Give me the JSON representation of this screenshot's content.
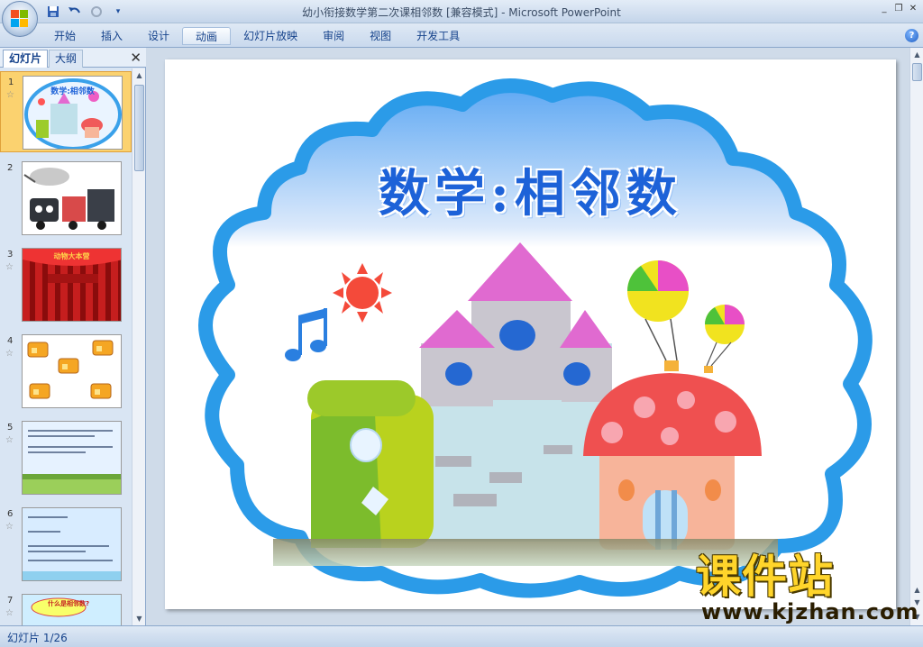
{
  "window": {
    "title": "幼小衔接数学第二次课相邻数 [兼容模式] - Microsoft PowerPoint"
  },
  "ribbon": {
    "tabs": [
      {
        "label": "开始"
      },
      {
        "label": "插入"
      },
      {
        "label": "设计"
      },
      {
        "label": "动画"
      },
      {
        "label": "幻灯片放映"
      },
      {
        "label": "审阅"
      },
      {
        "label": "视图"
      },
      {
        "label": "开发工具"
      }
    ],
    "selected_tab": "动画",
    "help_icon": "?"
  },
  "panel": {
    "tab_slides": "幻灯片",
    "tab_outline": "大纲",
    "close": "✕"
  },
  "thumbnails": [
    {
      "number": "1",
      "has_animation": true,
      "selected": true,
      "title": "数学:相邻数"
    },
    {
      "number": "2",
      "has_animation": false,
      "selected": false
    },
    {
      "number": "3",
      "has_animation": true,
      "selected": false,
      "title": "动物大本营"
    },
    {
      "number": "4",
      "has_animation": true,
      "selected": false
    },
    {
      "number": "5",
      "has_animation": true,
      "selected": false
    },
    {
      "number": "6",
      "has_animation": true,
      "selected": false
    },
    {
      "number": "7",
      "has_animation": true,
      "selected": false,
      "title": "什么是相邻数?"
    }
  ],
  "slide": {
    "title": "数学:相邻数"
  },
  "status": {
    "slide_counter": "幻灯片 1/26"
  },
  "watermark": {
    "brand": "课件站",
    "url": "www.kjzhan.com"
  },
  "colors": {
    "accent": "#1d62d8",
    "cloud_border": "#2b9be8",
    "selection": "#fbd26f"
  },
  "icons": [
    "office-button-icon",
    "save-icon",
    "undo-icon",
    "redo-icon",
    "customize-qat-icon",
    "minimize-icon",
    "restore-icon",
    "close-icon",
    "help-icon",
    "music-note-icon",
    "sun-icon",
    "balloon-icon"
  ]
}
